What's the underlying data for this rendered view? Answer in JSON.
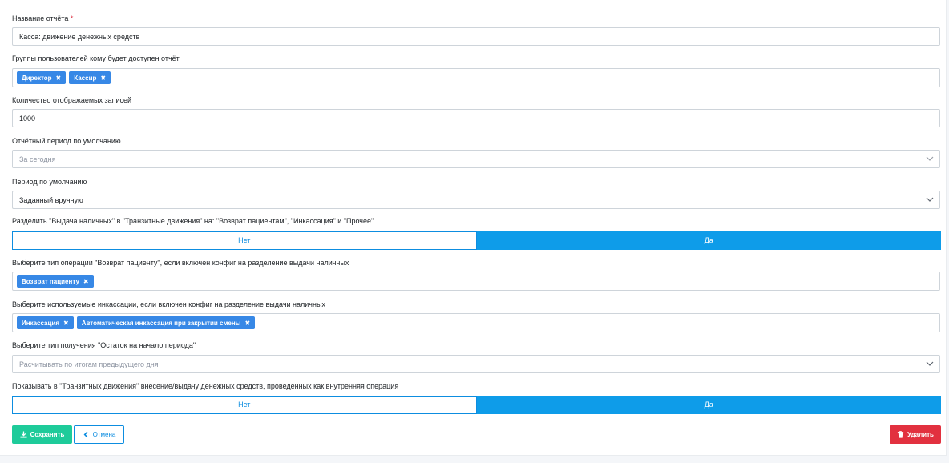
{
  "form": {
    "report_name": {
      "label": "Название отчёта",
      "required_mark": "*",
      "value": "Касса: движение денежных средств"
    },
    "user_groups": {
      "label": "Группы пользователей кому будет доступен отчёт",
      "tags": [
        "Директор",
        "Кассир"
      ]
    },
    "records_count": {
      "label": "Количество отображаемых записей",
      "value": "1000"
    },
    "default_report_period": {
      "label": "Отчётный период по умолчанию",
      "value": "За сегодня"
    },
    "default_period": {
      "label": "Период по умолчанию",
      "value": "Заданный вручную"
    },
    "split_cash": {
      "label": "Разделить \"Выдача наличных\" в \"Транзитные движения\" на: \"Возврат пациентам\", \"Инкассация\" и \"Прочее\".",
      "off_label": "Нет",
      "on_label": "Да",
      "selected": "on"
    },
    "refund_type": {
      "label": "Выберите тип операции \"Возврат пациенту\", если включен конфиг на разделение выдачи наличных",
      "tags": [
        "Возврат пациенту"
      ]
    },
    "collections": {
      "label": "Выберите используемые инкассации, если включен конфиг на разделение выдачи наличных",
      "tags": [
        "Инкассация",
        "Автоматическая инкассация при закрытии смены"
      ]
    },
    "opening_balance": {
      "label": "Выберите тип получения \"Остаток на начало периода\"",
      "value": "Расчитывать по итогам предыдущего дня"
    },
    "show_internal": {
      "label": "Показывать в \"Транзитных движения\" внесение/выдачу денежных средств, проведенных как внутренняя операция",
      "off_label": "Нет",
      "on_label": "Да",
      "selected": "on"
    }
  },
  "actions": {
    "save_label": "Сохранить",
    "cancel_label": "Отмена",
    "delete_label": "Удалить"
  },
  "icons": {
    "tag_remove": "close-icon",
    "save": "download-icon",
    "cancel": "chevron-left-icon",
    "delete": "trash-icon",
    "select": "chevron-down-icon"
  },
  "colors": {
    "tag": "#3788e6",
    "toggle_on": "#0e9ce9",
    "save": "#1ecb9a",
    "delete": "#e2313f",
    "required": "#dc3545"
  }
}
